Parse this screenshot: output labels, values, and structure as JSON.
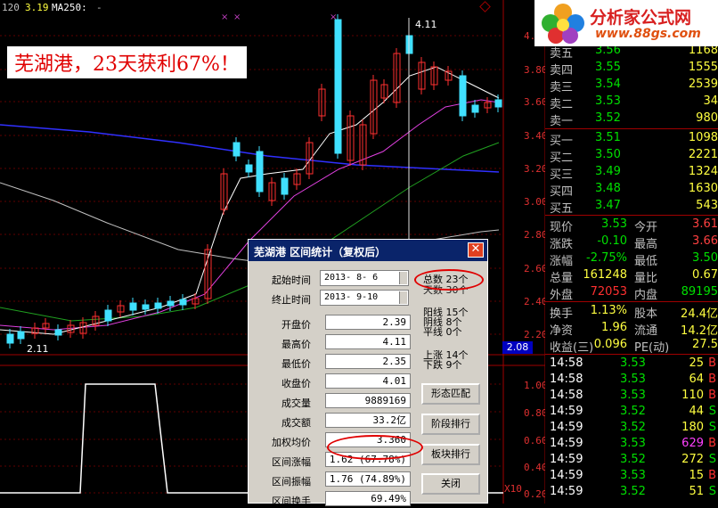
{
  "header": {
    "left_code": "120",
    "price": "3.19",
    "ma_label": "MA250:",
    "ma_dash": "-"
  },
  "promo": {
    "text": "芜湖港，23天获利67%！"
  },
  "logo": {
    "text": "分析家公式网",
    "url": "www.88gs.com"
  },
  "chart": {
    "high_label": "4.11",
    "low_label": "2.11",
    "current_price_box": "2.08",
    "y_axis_labels": [
      "4.0",
      "3.80",
      "3.60",
      "3.40",
      "3.20",
      "3.00",
      "2.80",
      "2.60",
      "2.40",
      "2.20"
    ],
    "sub_axis_labels": [
      "1.00",
      "0.80",
      "0.60",
      "0.40",
      "0.20"
    ],
    "sub_axis_unit": "X10"
  },
  "orderbook": {
    "asks": [
      {
        "label": "卖五",
        "price": "3.56",
        "vol": "1168"
      },
      {
        "label": "卖四",
        "price": "3.55",
        "vol": "1555"
      },
      {
        "label": "卖三",
        "price": "3.54",
        "vol": "2539"
      },
      {
        "label": "卖二",
        "price": "3.53",
        "vol": "34"
      },
      {
        "label": "卖一",
        "price": "3.52",
        "vol": "980"
      }
    ],
    "bids": [
      {
        "label": "买一",
        "price": "3.51",
        "vol": "1098"
      },
      {
        "label": "买二",
        "price": "3.50",
        "vol": "2221"
      },
      {
        "label": "买三",
        "price": "3.49",
        "vol": "1324"
      },
      {
        "label": "买四",
        "price": "3.48",
        "vol": "1630"
      },
      {
        "label": "买五",
        "price": "3.47",
        "vol": "543"
      }
    ]
  },
  "quote": [
    {
      "l1": "现价",
      "v1": "3.53",
      "l2": "今开",
      "v2": "3.61"
    },
    {
      "l1": "涨跌",
      "v1": "-0.10",
      "l2": "最高",
      "v2": "3.66"
    },
    {
      "l1": "涨幅",
      "v1": "-2.75%",
      "l2": "最低",
      "v2": "3.50"
    },
    {
      "l1": "总量",
      "v1": "161248",
      "l2": "量比",
      "v2": "0.67"
    },
    {
      "l1": "外盘",
      "v1": "72053",
      "l2": "内盘",
      "v2": "89195"
    }
  ],
  "quote2": [
    {
      "l1": "换手",
      "v1": "1.13%",
      "l2": "股本",
      "v2": "24.4亿"
    },
    {
      "l1": "净资",
      "v1": "1.96",
      "l2": "流通",
      "v2": "14.2亿"
    },
    {
      "l1": "收益(三)",
      "v1": "0.096",
      "l2": "PE(动)",
      "v2": "27.5"
    }
  ],
  "ticks": [
    {
      "time": "14:58",
      "price": "3.53",
      "vol": "25",
      "side": "B"
    },
    {
      "time": "14:58",
      "price": "3.53",
      "vol": "64",
      "side": "B"
    },
    {
      "time": "14:58",
      "price": "3.53",
      "vol": "110",
      "side": "B"
    },
    {
      "time": "14:59",
      "price": "3.52",
      "vol": "44",
      "side": "S"
    },
    {
      "time": "14:59",
      "price": "3.52",
      "vol": "180",
      "side": "S"
    },
    {
      "time": "14:59",
      "price": "3.53",
      "vol": "629",
      "side": "B"
    },
    {
      "time": "14:59",
      "price": "3.52",
      "vol": "272",
      "side": "S"
    },
    {
      "time": "14:59",
      "price": "3.53",
      "vol": "15",
      "side": "B"
    },
    {
      "time": "14:59",
      "price": "3.52",
      "vol": "51",
      "side": "S"
    }
  ],
  "dialog": {
    "title": "芜湖港  区间统计（复权后）",
    "start_label": "起始时间",
    "start_value": "2013- 8- 6",
    "end_label": "终止时间",
    "end_value": "2013- 9-10",
    "fields": [
      {
        "label": "开盘价",
        "value": "2.39"
      },
      {
        "label": "最高价",
        "value": "4.11"
      },
      {
        "label": "最低价",
        "value": "2.35"
      },
      {
        "label": "收盘价",
        "value": "4.01"
      },
      {
        "label": "成交量",
        "value": "9889169"
      },
      {
        "label": "成交额",
        "value": "33.2亿"
      },
      {
        "label": "加权均价",
        "value": "3.360"
      },
      {
        "label": "区间涨幅",
        "value": "1.62 (67.78%)"
      },
      {
        "label": "区间振幅",
        "value": "1.76 (74.89%)"
      },
      {
        "label": "区间换手",
        "value": "69.49%"
      }
    ],
    "total": "总数  23个",
    "rise_days": "天数  30个",
    "yang": "阳线  15个",
    "yin": "阴线  8个",
    "flat": "平线  0个",
    "up": "上涨  14个",
    "down": "下跌  9个",
    "btn_pattern": "形态匹配",
    "btn_rank": "阶段排行",
    "btn_sector": "板块排行",
    "btn_close": "关闭"
  }
}
